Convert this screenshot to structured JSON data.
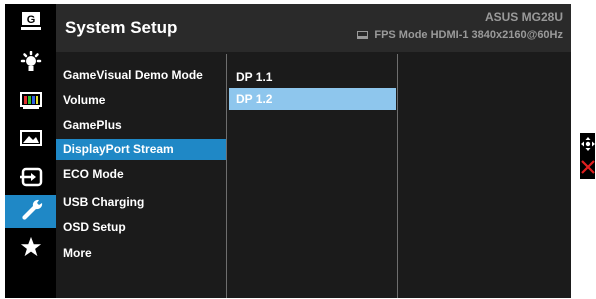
{
  "header": {
    "title": "System Setup",
    "model": "ASUS  MG28U",
    "status": "FPS Mode  HDMI-1  3840x2160@60Hz"
  },
  "icon_bar": [
    {
      "name": "gamevisual-icon",
      "active": false
    },
    {
      "name": "bluelight-filter-icon",
      "active": false
    },
    {
      "name": "color-icon",
      "active": false
    },
    {
      "name": "image-icon",
      "active": false
    },
    {
      "name": "input-select-icon",
      "active": false
    },
    {
      "name": "system-setup-icon",
      "active": true
    },
    {
      "name": "myfavorite-icon",
      "active": false
    }
  ],
  "menu": {
    "items": [
      {
        "label": "GameVisual Demo Mode",
        "selected": false
      },
      {
        "label": "Volume",
        "selected": false
      },
      {
        "label": "GamePlus",
        "selected": false
      },
      {
        "label": "DisplayPort Stream",
        "selected": true
      },
      {
        "label": "ECO Mode",
        "selected": false
      },
      {
        "label": "USB Charging",
        "selected": false
      },
      {
        "label": "OSD Setup",
        "selected": false
      },
      {
        "label": "More",
        "selected": false
      }
    ]
  },
  "submenu": {
    "items": [
      {
        "label": "DP 1.1",
        "selected": false
      },
      {
        "label": "DP 1.2",
        "selected": true
      }
    ]
  },
  "nav_keys": [
    {
      "name": "five-way-navigation-icon"
    },
    {
      "name": "exit-icon"
    }
  ],
  "colors": {
    "accent": "#1f88c6",
    "submenu_highlight": "#8ec6ed",
    "panel": "#1b1b1b",
    "header": "#2a2a2a",
    "exit": "#e02020"
  }
}
